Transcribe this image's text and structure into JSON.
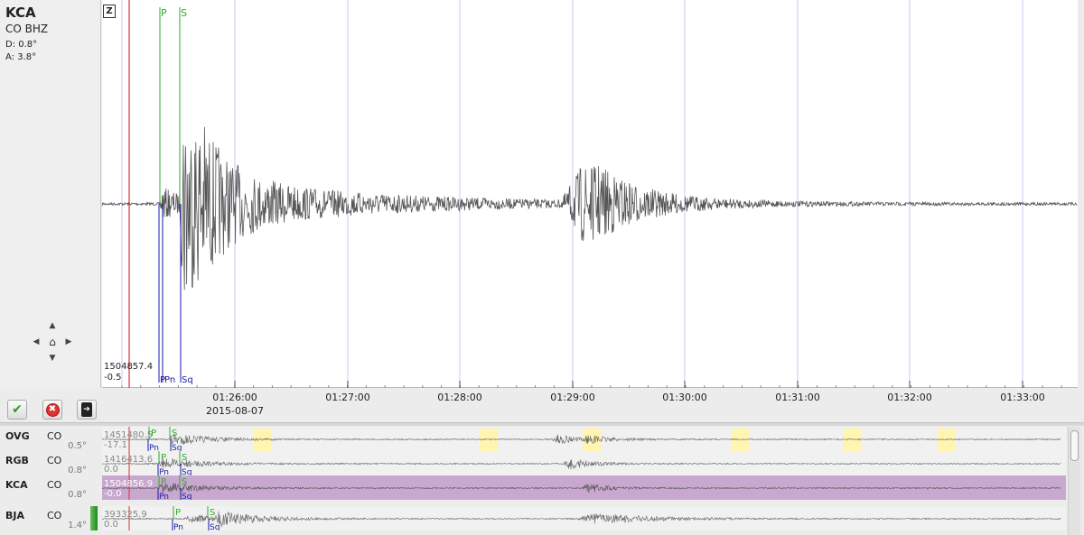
{
  "station": {
    "code": "KCA",
    "network_channel": "CO  BHZ",
    "distance": "D:  0.8°",
    "azimuth": "A:  3.8°"
  },
  "trace": {
    "component": "Z",
    "amp_top": "1504857.4",
    "amp_bottom": "-0.5",
    "date": "2015-08-07",
    "ticks": [
      "01:26:00",
      "01:27:00",
      "01:28:00",
      "01:29:00",
      "01:30:00",
      "01:31:00",
      "01:32:00",
      "01:33:00"
    ],
    "pick_labels": {
      "P": "P",
      "S": "S",
      "Pn": "Pn",
      "Sq": "Sq"
    }
  },
  "buttons": {
    "accept_icon": "check-icon",
    "reject_icon": "reject-icon",
    "next_icon": "next-icon"
  },
  "rows": [
    {
      "station": "OVG",
      "network": "CO",
      "distance": "0.5°",
      "amp1": "1451480.5",
      "amp2": "-17.1",
      "selected": false
    },
    {
      "station": "RGB",
      "network": "CO",
      "distance": "0.8°",
      "amp1": "1416413.6",
      "amp2": "0.0",
      "selected": false
    },
    {
      "station": "KCA",
      "network": "CO",
      "distance": "0.8°",
      "amp1": "1504856.9",
      "amp2": "-0.0",
      "selected": true
    },
    {
      "station": "BJA",
      "network": "CO",
      "distance": "1.4°",
      "amp1": "393325.9",
      "amp2": "0.0",
      "selected": false
    }
  ],
  "colors": {
    "trace": "#555555",
    "p_pick": "#2eaa2e",
    "theoretical_pick": "#1a1aa8",
    "origin_line": "#e03030",
    "grid": "#c8c8f0",
    "selected_row": "#c9a8cf",
    "gap_highlight": "#fff5b0"
  }
}
